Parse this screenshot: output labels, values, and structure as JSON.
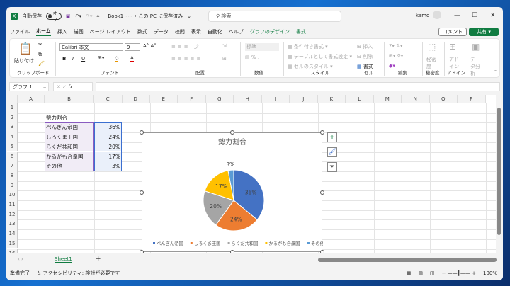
{
  "titlebar": {
    "autosave_label": "自動保存",
    "autosave_state": "オフ",
    "doc_title": "Book1 ･･･ • この PC に保存済み",
    "search_placeholder": "検索",
    "user": "kamo",
    "minimize": "—",
    "maximize": "☐",
    "close": "✕"
  },
  "menu": [
    "ファイル",
    "ホーム",
    "挿入",
    "描画",
    "ページ レイアウト",
    "数式",
    "データ",
    "校閲",
    "表示",
    "自動化",
    "ヘルプ",
    "グラフのデザイン",
    "書式"
  ],
  "menu_active": "ホーム",
  "comment_btn": "コメント",
  "share_btn": "共有",
  "ribbon": {
    "clipboard": {
      "paste": "貼り付け",
      "label": "クリップボード"
    },
    "font": {
      "name": "Calibri 本文",
      "size": "9",
      "label": "フォント",
      "bold": "B",
      "italic": "I",
      "underline": "U"
    },
    "align": {
      "label": "配置"
    },
    "number": {
      "format": "標準",
      "label": "数値"
    },
    "style": {
      "cond": "条件付き書式",
      "table": "テーブルとして書式設定",
      "cell": "セルのスタイル",
      "label": "スタイル"
    },
    "cells": {
      "insert": "挿入",
      "delete": "削除",
      "format": "書式",
      "label": "セル"
    },
    "edit": {
      "label": "編集"
    },
    "sens": {
      "btn": "秘密度",
      "label": "秘密度"
    },
    "addin": {
      "btn": "アドイン",
      "label": "アドイン"
    },
    "analyze": {
      "btn": "データ分析"
    }
  },
  "formula": {
    "namebox": "グラフ 1",
    "fx": "fx",
    "value": ""
  },
  "columns": [
    "A",
    "B",
    "C",
    "D",
    "E",
    "F",
    "G",
    "H",
    "I",
    "J",
    "K",
    "L",
    "M",
    "N",
    "O",
    "P"
  ],
  "rows": [
    "1",
    "2",
    "3",
    "4",
    "5",
    "6",
    "7",
    "8",
    "9",
    "10",
    "11",
    "12",
    "13",
    "14",
    "15",
    "16"
  ],
  "cells": {
    "B2": "勢力割合",
    "table": [
      [
        "ぺんぎん帝国",
        "36%"
      ],
      [
        "しろくま王国",
        "24%"
      ],
      [
        "らくだ共和国",
        "20%"
      ],
      [
        "かるがも合衆国",
        "17%"
      ],
      [
        "その他",
        "3%"
      ]
    ]
  },
  "chart_data": {
    "type": "pie",
    "title": "勢力割合",
    "categories": [
      "ぺんぎん帝国",
      "しろくま王国",
      "らくだ共和国",
      "かるがも合衆国",
      "その他"
    ],
    "values": [
      36,
      24,
      20,
      17,
      3
    ],
    "labels": [
      "36%",
      "24%",
      "20%",
      "17%",
      "3%"
    ],
    "colors": [
      "#4472c4",
      "#ed7d31",
      "#a5a5a5",
      "#ffc000",
      "#5b9bd5"
    ],
    "legend": "bottom"
  },
  "sheet_tab": "Sheet1",
  "status": {
    "ready": "準備完了",
    "access": "アクセシビリティ: 検討が必要です",
    "zoom": "100%"
  }
}
